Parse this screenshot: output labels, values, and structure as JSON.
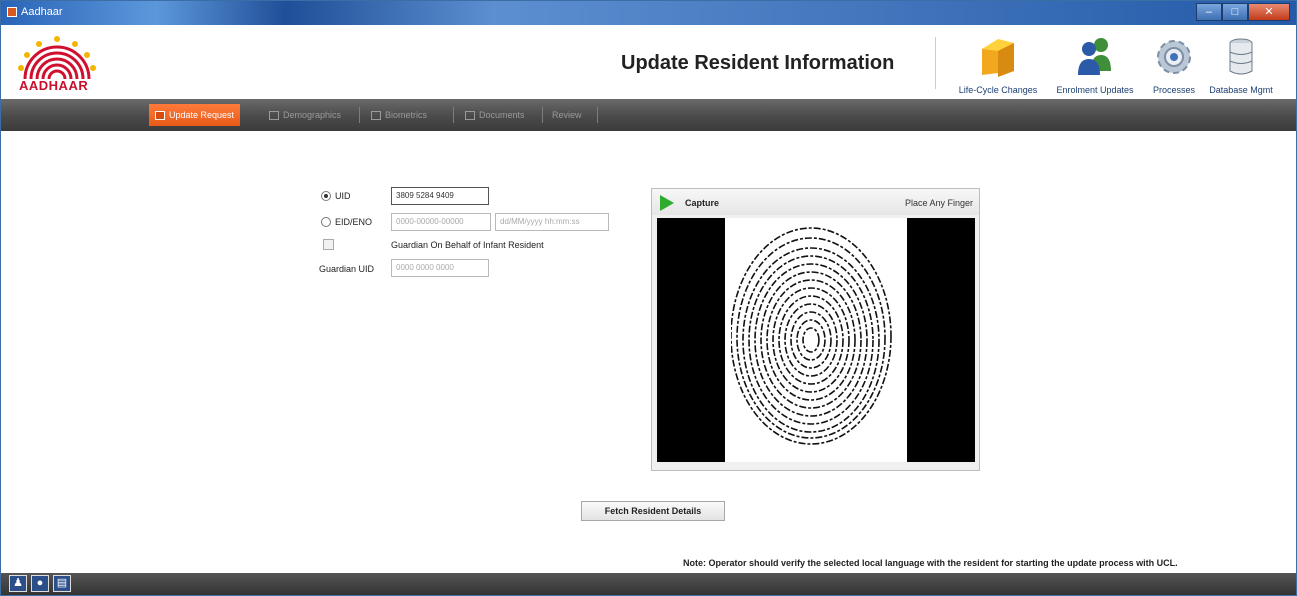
{
  "window": {
    "title": "Aadhaar",
    "controls": [
      "‒",
      "□",
      "✕"
    ]
  },
  "header": {
    "logo_text": "AADHAAR",
    "page_title": "Update Resident Information",
    "tools": [
      {
        "label": "Life-Cycle Changes",
        "icon": "folder-icon"
      },
      {
        "label": "Enrolment Updates",
        "icon": "users-icon"
      },
      {
        "label": "Processes",
        "icon": "gear-icon"
      },
      {
        "label": "Database Mgmt",
        "icon": "database-icon"
      }
    ]
  },
  "nav": {
    "tabs": [
      {
        "label": "Update Request",
        "active": true
      },
      {
        "label": "Demographics",
        "active": false
      },
      {
        "label": "Biometrics",
        "active": false
      },
      {
        "label": "Documents",
        "active": false
      },
      {
        "label": "Review",
        "active": false
      }
    ]
  },
  "form": {
    "uid_label": "UID",
    "uid_value": "3809 5284 9409",
    "eid_label": "EID/ENO",
    "eid_placeholder": "0000-00000-00000",
    "eid_date_placeholder": "dd/MM/yyyy hh:mm:ss",
    "guardian_checkbox_label": "Guardian On Behalf of Infant Resident",
    "guardian_uid_label": "Guardian UID",
    "guardian_uid_placeholder": "0000 0000 0000"
  },
  "capture": {
    "label": "Capture",
    "hint": "Place Any Finger"
  },
  "actions": {
    "fetch_label": "Fetch Resident Details"
  },
  "note": "Note: Operator should verify the selected local language with the resident for starting the update process with UCL.",
  "colors": {
    "accent": "#e85a18",
    "brand": "#c8102e",
    "capture_green": "#2eaa2e"
  }
}
